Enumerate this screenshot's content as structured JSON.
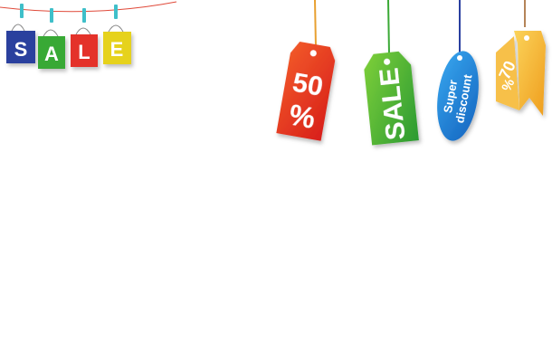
{
  "bags": [
    {
      "letter": "S",
      "color": "#2b3f9e"
    },
    {
      "letter": "A",
      "color": "#39a935"
    },
    {
      "letter": "L",
      "color": "#e4322b"
    },
    {
      "letter": "E",
      "color": "#e6d21a"
    }
  ],
  "tags": {
    "fifty": {
      "number": "50",
      "percent": "%",
      "color": "#e8321c"
    },
    "sale": {
      "text": "SALE",
      "color": "#3aa935"
    },
    "super": {
      "line1": "Super",
      "line2": "discount",
      "color": "#1f86d6"
    },
    "seventy": {
      "number": "70",
      "percent": "%",
      "color": "#f3b52a"
    }
  },
  "colors": {
    "string": "#e04a3a",
    "clothespin": "#3fbfc9"
  }
}
